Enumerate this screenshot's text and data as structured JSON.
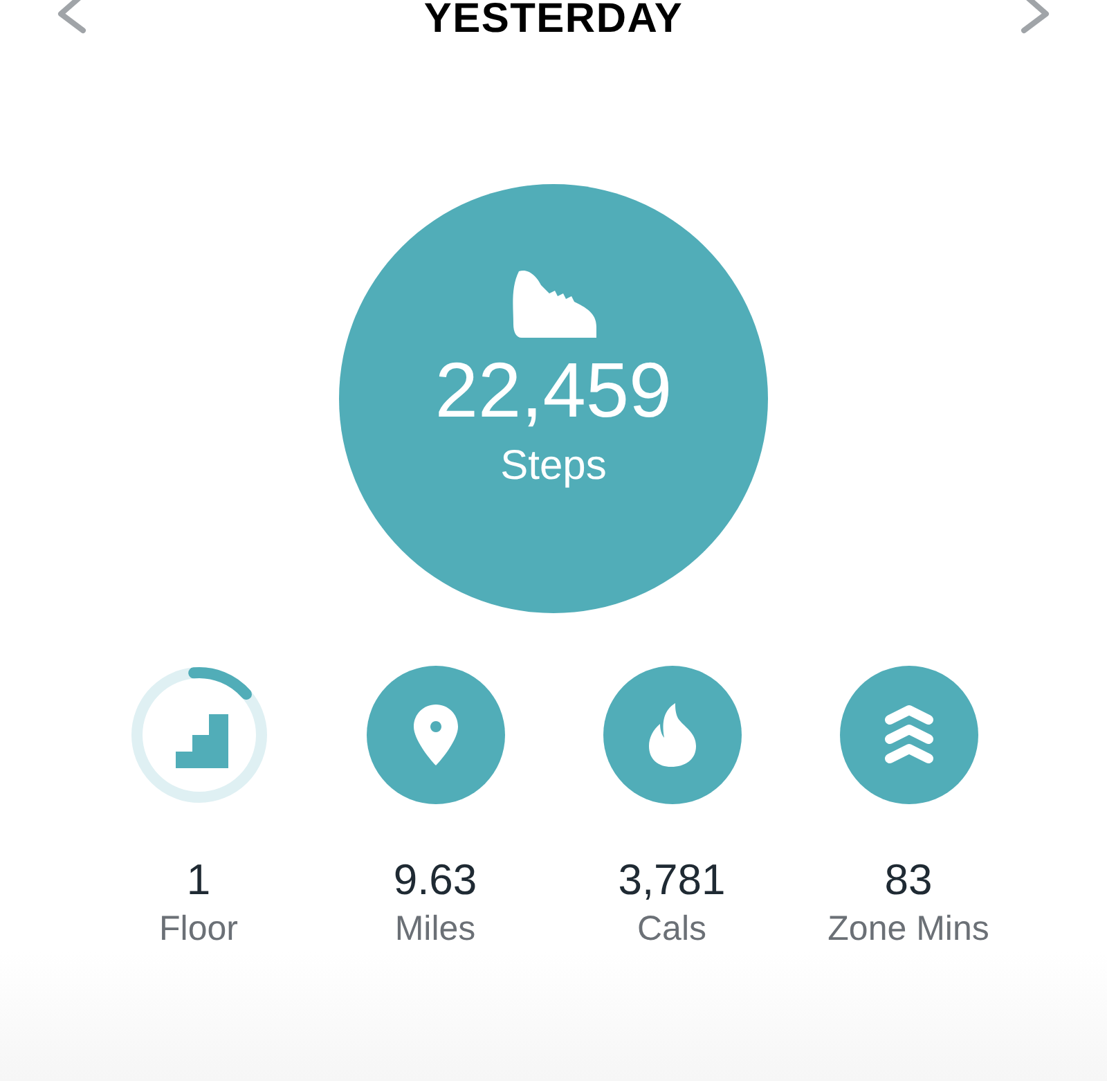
{
  "header": {
    "title": "YESTERDAY"
  },
  "steps": {
    "value": "22,459",
    "label": "Steps"
  },
  "stats": [
    {
      "kind": "ring",
      "level": 0.15,
      "value": "1",
      "label": "Floor"
    },
    {
      "kind": "filled",
      "value": "9.63",
      "label": "Miles"
    },
    {
      "kind": "filled",
      "value": "3,781",
      "label": "Cals"
    },
    {
      "kind": "filled",
      "value": "83",
      "label": "Zone Mins"
    }
  ]
}
